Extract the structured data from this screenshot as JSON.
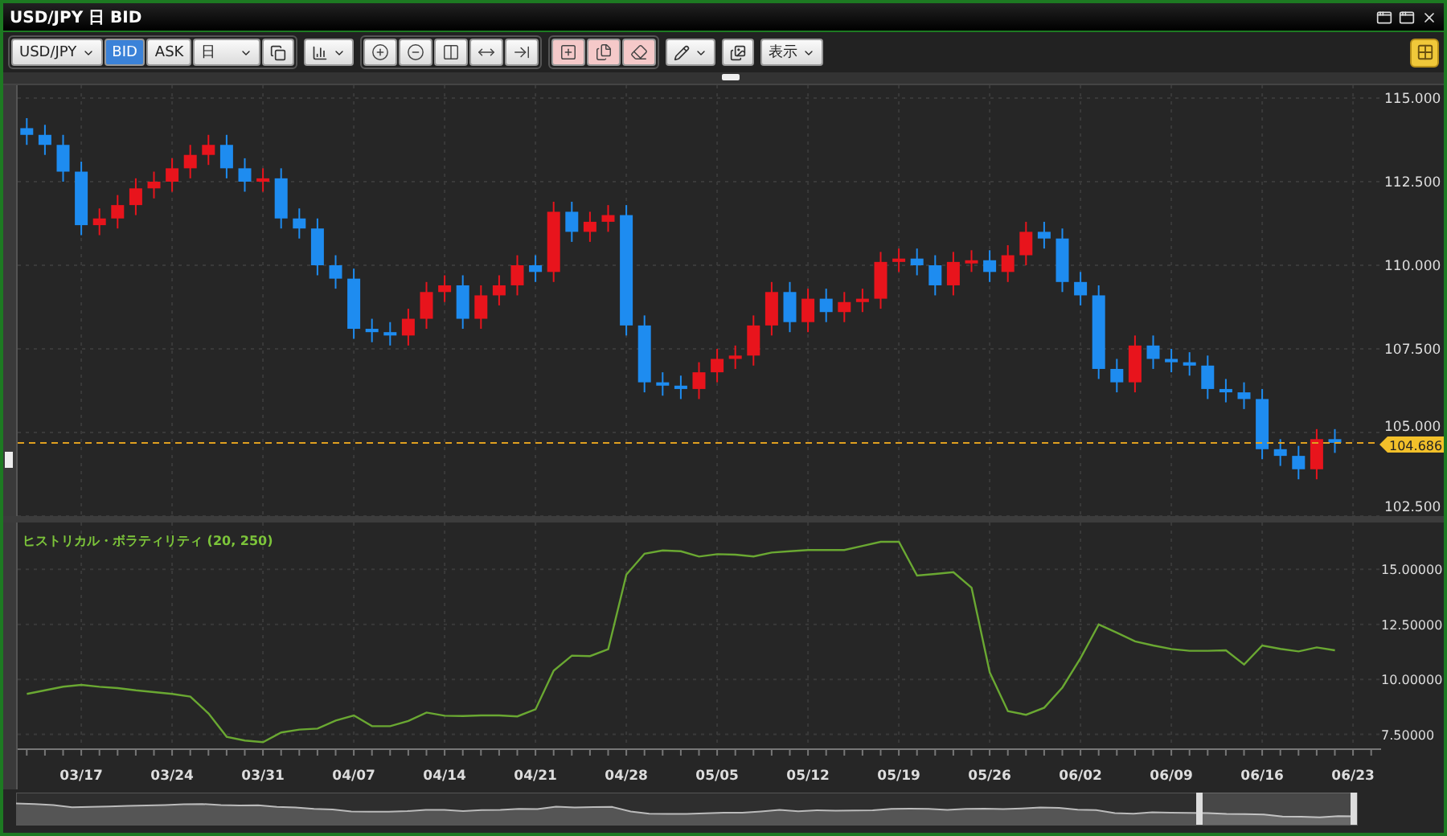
{
  "window": {
    "title": "USD/JPY 日 BID"
  },
  "toolbar": {
    "symbol": "USD/JPY",
    "price_sides": [
      {
        "label": "BID",
        "selected": true
      },
      {
        "label": "ASK",
        "selected": false
      }
    ],
    "period": "日",
    "tool_buttons": [
      {
        "kind": "zoom-in",
        "active": false
      },
      {
        "kind": "zoom-out",
        "active": false
      },
      {
        "kind": "fit",
        "active": false
      },
      {
        "kind": "stretch",
        "active": false
      },
      {
        "kind": "scroll-end",
        "active": false
      },
      {
        "kind": "add-drawing",
        "active": true
      },
      {
        "kind": "copy-drawing",
        "active": true
      },
      {
        "kind": "erase-drawing",
        "active": true
      }
    ],
    "display_menu": "表示"
  },
  "price_chart": {
    "axis_labels": [
      "115.000",
      "112.500",
      "110.000",
      "107.500",
      "105.000",
      "102.500"
    ],
    "current_price": "104.686"
  },
  "indicator_chart": {
    "chart_data": {
      "type": "line",
      "categories": [
        null,
        null,
        null,
        "03/17",
        null,
        null,
        null,
        null,
        "03/24",
        null,
        null,
        null,
        null,
        "03/31",
        null,
        null,
        null,
        null,
        "04/07",
        null,
        null,
        null,
        null,
        "04/14",
        null,
        null,
        null,
        null,
        "04/21",
        null,
        null,
        null,
        null,
        "04/28",
        null,
        null,
        null,
        null,
        "05/05",
        null,
        null,
        null,
        null,
        "05/12",
        null,
        null,
        null,
        null,
        "05/19",
        null,
        null,
        null,
        null,
        "05/26",
        null,
        null,
        null,
        null,
        "06/02",
        null,
        null,
        null,
        null,
        "06/09",
        null,
        null,
        null,
        null,
        "06/16",
        null,
        null,
        null,
        null,
        "06/23"
      ],
      "series": [
        {
          "name": "ヒストリカル・ボラティリティ (20, 250)",
          "color": "#6aa832",
          "values": [
            9.34,
            9.5,
            9.67,
            9.75,
            9.66,
            9.6,
            9.5,
            9.42,
            9.34,
            9.22,
            8.45,
            7.39,
            7.22,
            7.15,
            7.59,
            7.72,
            7.76,
            8.13,
            8.36,
            7.87,
            7.87,
            8.11,
            8.49,
            8.35,
            8.33,
            8.36,
            8.36,
            8.32,
            8.64,
            10.4,
            11.08,
            11.06,
            11.37,
            14.76,
            15.71,
            15.86,
            15.82,
            15.58,
            15.69,
            15.67,
            15.59,
            15.76,
            15.82,
            15.88,
            15.88,
            15.88,
            16.06,
            16.25,
            16.25,
            14.72,
            14.79,
            14.87,
            14.16,
            10.31,
            8.55,
            8.39,
            8.71,
            9.63,
            10.97,
            12.5,
            12.12,
            11.73,
            11.54,
            11.38,
            11.3,
            11.3,
            11.32,
            10.68,
            11.54,
            11.39,
            11.27,
            11.45,
            11.32,
            null
          ]
        }
      ],
      "grid": true,
      "ylim": [
        6.9,
        17.13
      ],
      "yticks": [
        {
          "value": 15,
          "label": "15.00000"
        },
        {
          "value": 12.5,
          "label": "12.50000"
        },
        {
          "value": 10,
          "label": "10.00000"
        },
        {
          "value": 7.5,
          "label": "7.50000"
        }
      ]
    }
  }
}
